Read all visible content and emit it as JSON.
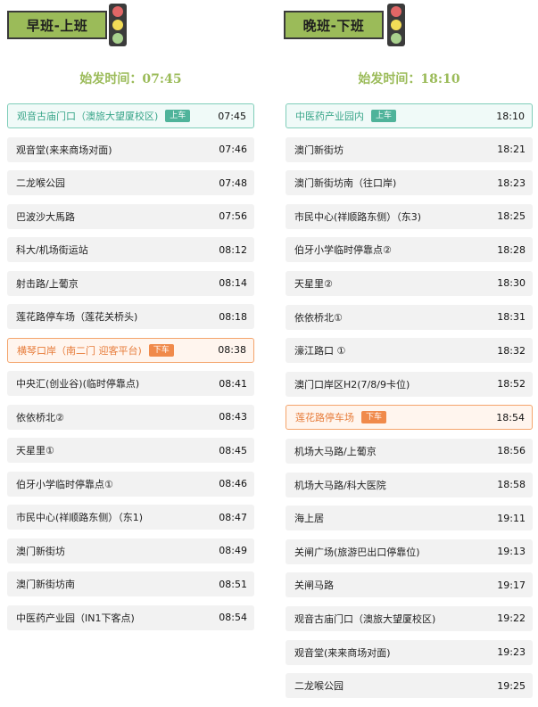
{
  "morning": {
    "title": "早班-上班",
    "depart_label": "始发时间：",
    "depart_time": "07:45",
    "stops": [
      {
        "name": "观音古庙门口（澳旅大望厦校区)",
        "time": "07:45",
        "tag": "上车",
        "type": "board"
      },
      {
        "name": "观音堂(来来商场对面)",
        "time": "07:46"
      },
      {
        "name": "二龙喉公园",
        "time": "07:48"
      },
      {
        "name": "巴波沙大馬路",
        "time": "07:56"
      },
      {
        "name": "科大/机场街运站",
        "time": "08:12"
      },
      {
        "name": "射击路/上葡京",
        "time": "08:14"
      },
      {
        "name": "莲花路停车场（莲花关桥头)",
        "time": "08:18"
      },
      {
        "name": "横琴口岸（南二门 迎客平台)",
        "time": "08:38",
        "tag": "下车",
        "type": "alight"
      },
      {
        "name": "中央汇(创业谷)(临时停靠点)",
        "time": "08:41"
      },
      {
        "name": "依依桥北②",
        "time": "08:43"
      },
      {
        "name": "天星里①",
        "time": "08:45"
      },
      {
        "name": "伯牙小学临时停靠点①",
        "time": "08:46"
      },
      {
        "name": "市民中心(祥顺路东侧）（东1)",
        "time": "08:47"
      },
      {
        "name": "澳门新街坊",
        "time": "08:49"
      },
      {
        "name": "澳门新街坊南",
        "time": "08:51"
      },
      {
        "name": "中医药产业园（IN1下客点)",
        "time": "08:54"
      }
    ]
  },
  "evening": {
    "title": "晚班-下班",
    "depart_label": "始发时间：",
    "depart_time": "18:10",
    "stops": [
      {
        "name": "中医药产业园内",
        "time": "18:10",
        "tag": "上车",
        "type": "board"
      },
      {
        "name": "澳门新街坊",
        "time": "18:21"
      },
      {
        "name": "澳门新街坊南（往口岸)",
        "time": "18:23"
      },
      {
        "name": "市民中心(祥顺路东侧）（东3)",
        "time": "18:25"
      },
      {
        "name": "伯牙小学临时停靠点②",
        "time": "18:28"
      },
      {
        "name": "天星里②",
        "time": "18:30"
      },
      {
        "name": "依依桥北①",
        "time": "18:31"
      },
      {
        "name": "濠江路口 ①",
        "time": "18:32"
      },
      {
        "name": "澳门口岸区H2(7/8/9卡位)",
        "time": "18:52"
      },
      {
        "name": "莲花路停车场",
        "time": "18:54",
        "tag": "下车",
        "type": "alight"
      },
      {
        "name": "机场大马路/上葡京",
        "time": "18:56"
      },
      {
        "name": "机场大马路/科大医院",
        "time": "18:58"
      },
      {
        "name": "海上居",
        "time": "19:11"
      },
      {
        "name": "关闸广场(旅游巴出口停靠位)",
        "time": "19:13"
      },
      {
        "name": "关闸马路",
        "time": "19:17"
      },
      {
        "name": "观音古庙门口（澳旅大望厦校区)",
        "time": "19:22"
      },
      {
        "name": "观音堂(来来商场对面)",
        "time": "19:23"
      },
      {
        "name": "二龙喉公园",
        "time": "19:25"
      }
    ]
  },
  "icons": {
    "traffic_light": "traffic-light-icon"
  },
  "colors": {
    "accent_green": "#9bbb59",
    "board_tag": "#4fb39a",
    "alight_tag": "#f08a4b"
  }
}
